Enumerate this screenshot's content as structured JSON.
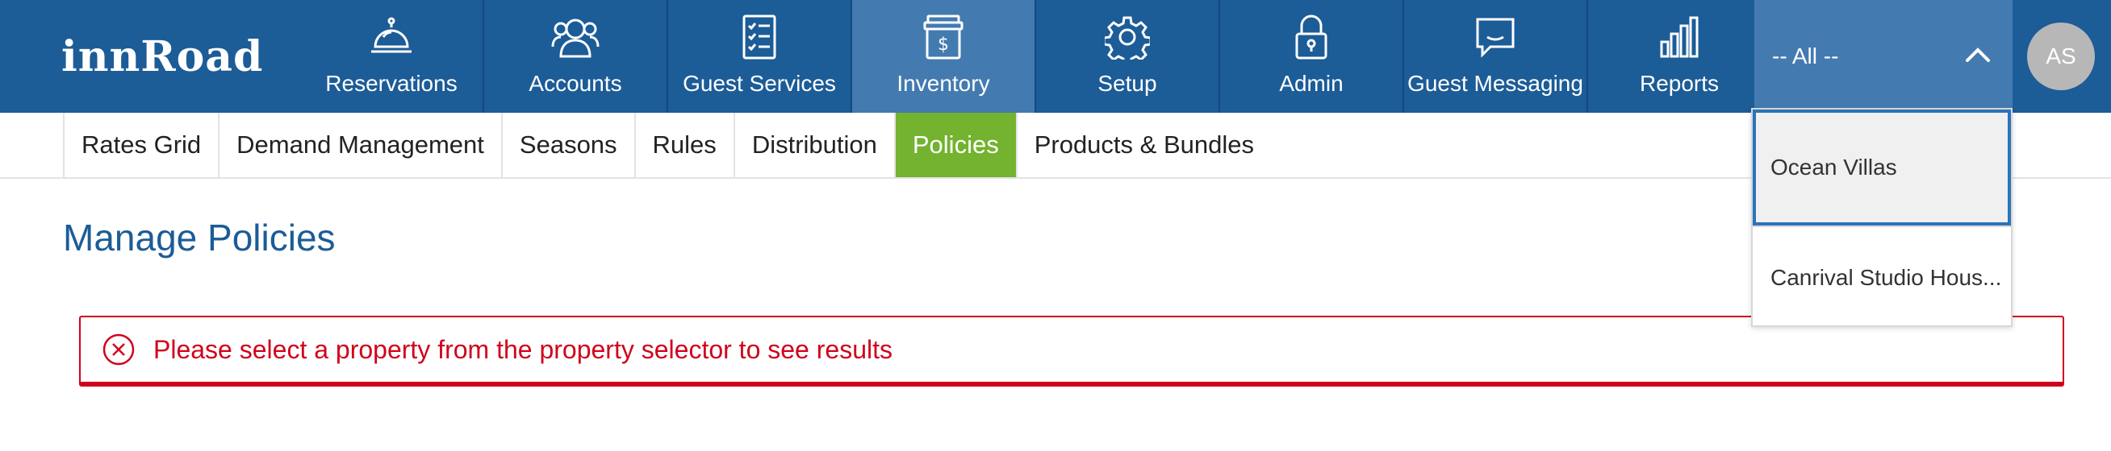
{
  "brand": {
    "logo_text": "innRoad"
  },
  "topnav": {
    "items": [
      {
        "label": "Reservations",
        "icon": "service-bell-icon"
      },
      {
        "label": "Accounts",
        "icon": "users-icon"
      },
      {
        "label": "Guest Services",
        "icon": "checklist-icon"
      },
      {
        "label": "Inventory",
        "icon": "inventory-box-icon",
        "active": true
      },
      {
        "label": "Setup",
        "icon": "gear-icon"
      },
      {
        "label": "Admin",
        "icon": "lock-icon"
      },
      {
        "label": "Guest Messaging",
        "icon": "chat-icon"
      },
      {
        "label": "Reports",
        "icon": "bar-chart-icon"
      }
    ]
  },
  "property_selector": {
    "value": "-- All --",
    "options": [
      "Ocean Villas",
      "Canrival Studio Hous..."
    ],
    "highlighted": "Ocean Villas"
  },
  "user": {
    "initials": "AS"
  },
  "subnav": {
    "tabs": [
      "Rates Grid",
      "Demand Management",
      "Seasons",
      "Rules",
      "Distribution",
      "Policies",
      "Products & Bundles"
    ],
    "active": "Policies"
  },
  "page": {
    "title": "Manage Policies",
    "alert": {
      "message": "Please select a property from the property selector to see results"
    }
  },
  "colors": {
    "header_bg": "#1c5c97",
    "header_active": "#437bb0",
    "tab_active": "#73b32f",
    "error": "#d0021b",
    "title": "#1c5c97"
  }
}
